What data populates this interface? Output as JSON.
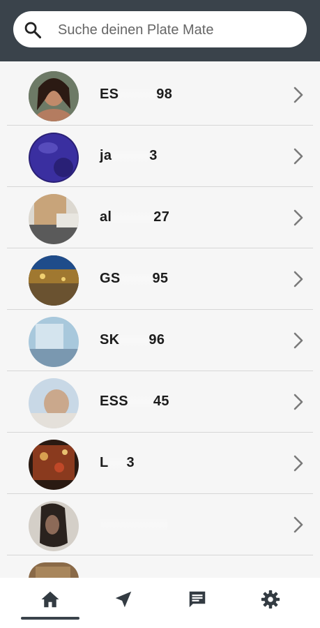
{
  "search": {
    "placeholder": "Suche deinen Plate Mate",
    "icon": "search-icon"
  },
  "list": {
    "items": [
      {
        "name_start": "ES",
        "name_end": "98",
        "avatar": "avatar-woman-portrait",
        "chevron": "chevron-right-icon"
      },
      {
        "name_start": "ja",
        "name_end": "3",
        "avatar": "avatar-purple-sphere",
        "chevron": "chevron-right-icon"
      },
      {
        "name_start": "al",
        "name_end": "27",
        "avatar": "avatar-blurred-photo",
        "chevron": "chevron-right-icon"
      },
      {
        "name_start": "GS",
        "name_end": "95",
        "avatar": "avatar-harbor-night",
        "chevron": "chevron-right-icon"
      },
      {
        "name_start": "SK",
        "name_end": "96",
        "avatar": "avatar-pale-sky",
        "chevron": "chevron-right-icon"
      },
      {
        "name_start": "ESS",
        "name_end": "45",
        "avatar": "avatar-baby-photo",
        "chevron": "chevron-right-icon"
      },
      {
        "name_start": "L",
        "name_end": "3",
        "avatar": "avatar-red-pattern",
        "chevron": "chevron-right-icon"
      },
      {
        "name_start": "",
        "name_end": "",
        "avatar": "avatar-dark-portrait",
        "chevron": "chevron-right-icon"
      }
    ]
  },
  "bottom_nav": {
    "items": [
      "home-icon",
      "navigation-arrow-icon",
      "chat-icon",
      "settings-gear-icon"
    ],
    "active": "home-icon"
  },
  "colors": {
    "header": "#3a434b",
    "background": "#f6f6f6",
    "text": "#1c1c1c",
    "chevron": "#7a7a7a"
  }
}
